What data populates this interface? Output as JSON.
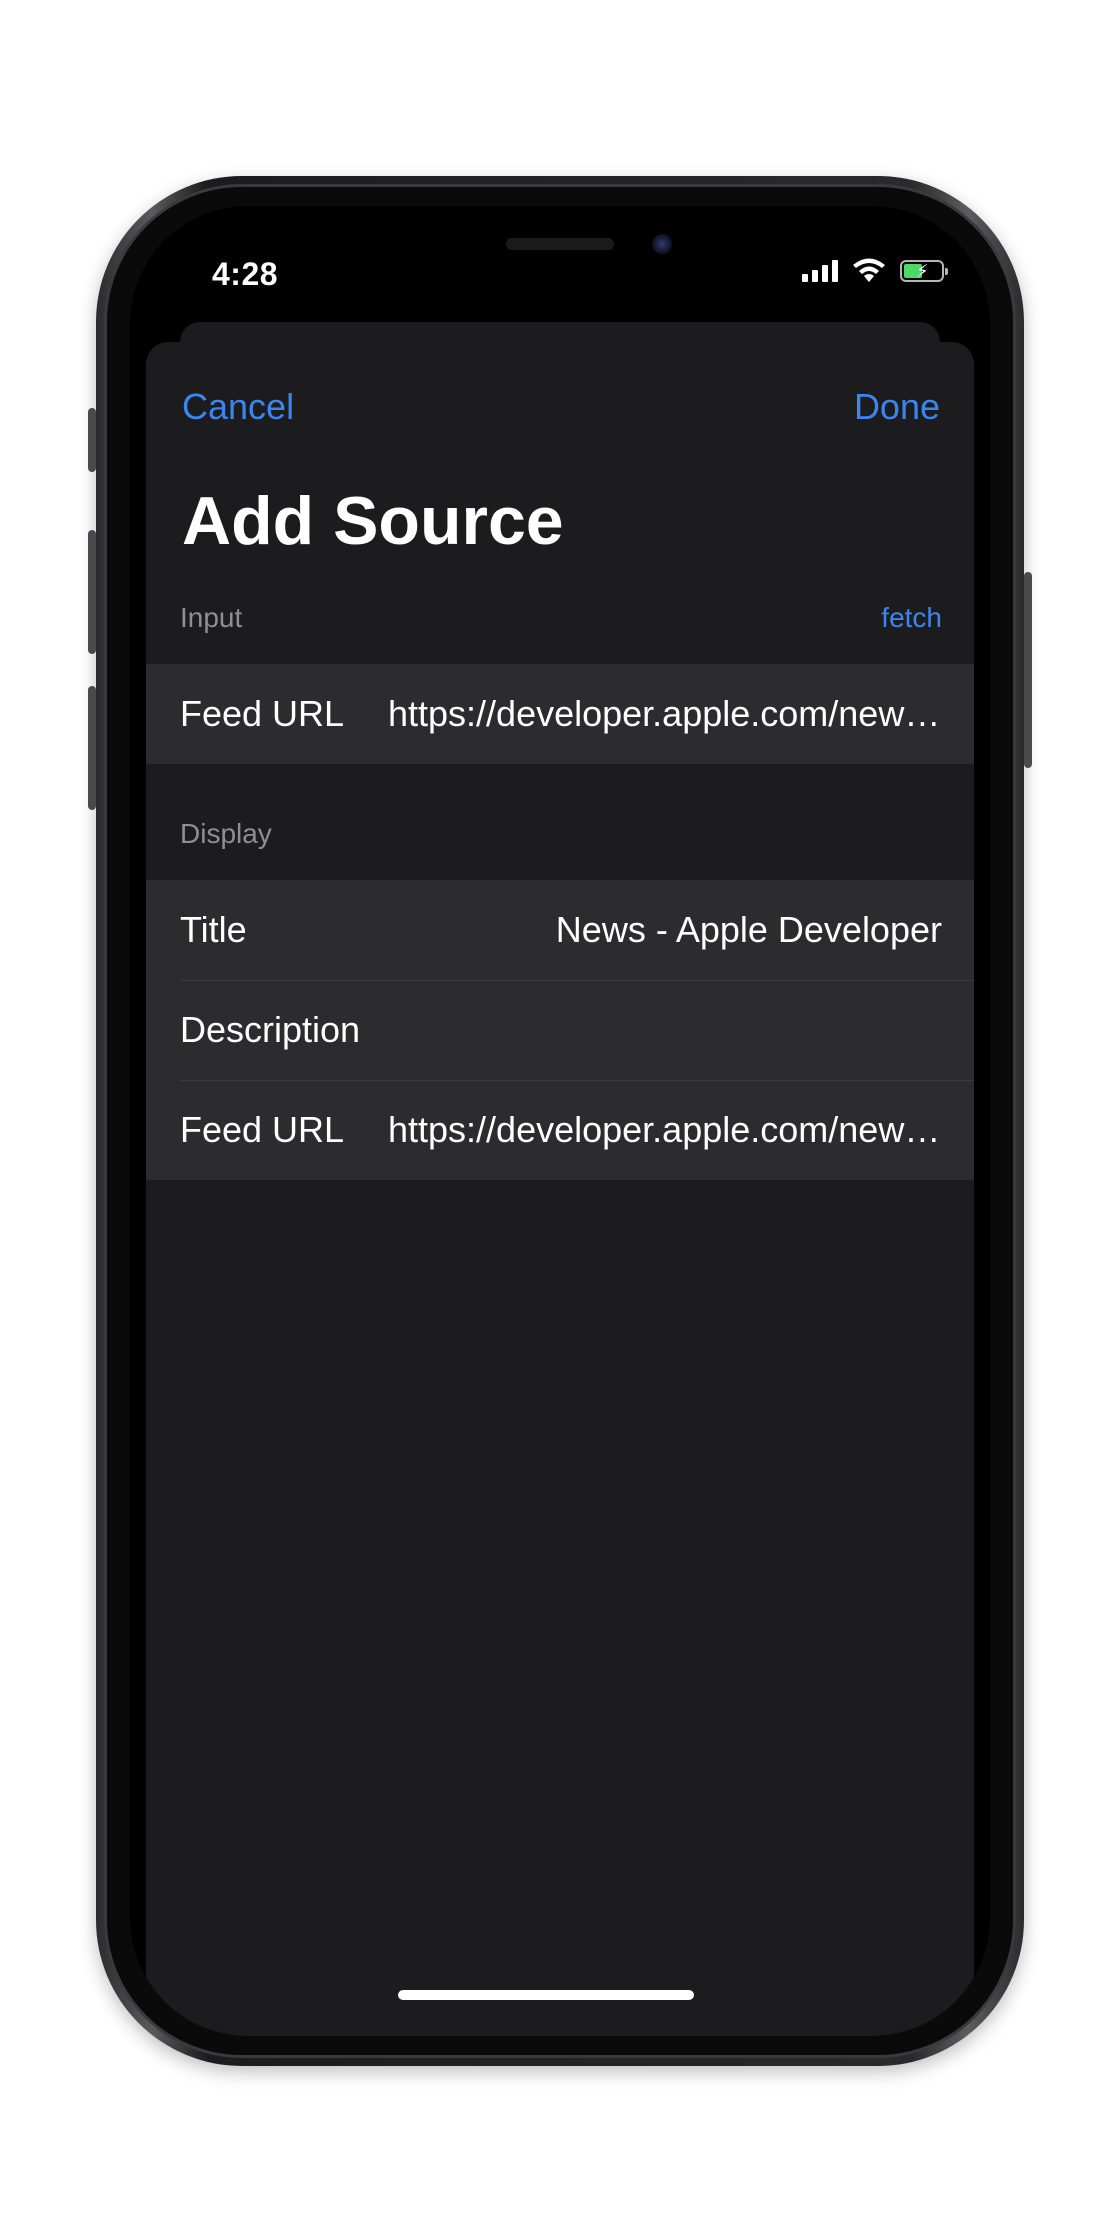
{
  "status_bar": {
    "time": "4:28",
    "icons": [
      "cellular-signal-icon",
      "wifi-icon",
      "battery-charging-icon"
    ]
  },
  "nav": {
    "cancel_label": "Cancel",
    "done_label": "Done"
  },
  "title": "Add Source",
  "sections": {
    "input": {
      "header": "Input",
      "action_label": "fetch",
      "rows": [
        {
          "label": "Feed URL",
          "value": "https://developer.apple.com/news/rss/news.rss"
        }
      ]
    },
    "display": {
      "header": "Display",
      "rows": [
        {
          "label": "Title",
          "value": "News - Apple Developer"
        },
        {
          "label": "Description",
          "value": ""
        },
        {
          "label": "Feed URL",
          "value": "https://developer.apple.com/news/rss/news.rss"
        }
      ]
    }
  },
  "colors": {
    "accent": "#3a86f0",
    "sheet_background": "#1c1c1e",
    "cell_background": "#2c2c2e",
    "secondary_text": "#8e8e93"
  }
}
